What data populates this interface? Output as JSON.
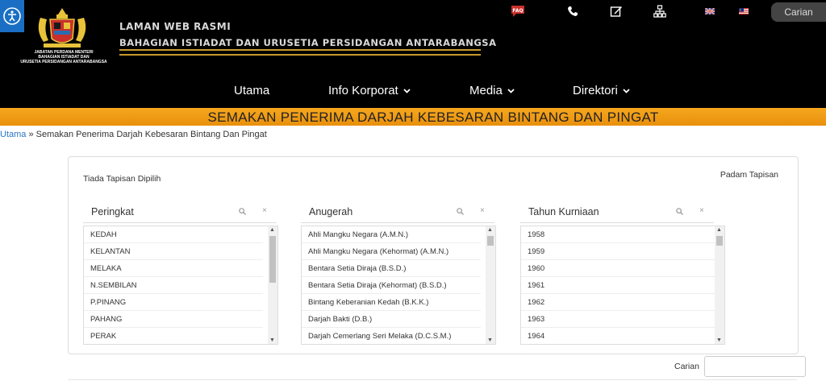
{
  "header": {
    "logo_caption": [
      "JABATAN PERDANA MENTERI",
      "BAHAGIAN ISTIADAT DAN",
      "URUSETIA PERSIDANGAN ANTARABANGSA"
    ],
    "title_line1": "LAMAN WEB RASMI",
    "title_line2": "BAHAGIAN ISTIADAT  DAN URUSETIA PERSIDANGAN ANTARABANGSA",
    "search_label": "Carian",
    "faq_label": "FAQ"
  },
  "nav": {
    "items": [
      {
        "label": "Utama"
      },
      {
        "label": "Info Korporat"
      },
      {
        "label": "Media"
      },
      {
        "label": "Direktori"
      }
    ]
  },
  "banner": {
    "title": "SEMAKAN PENERIMA DARJAH KEBESARAN BINTANG DAN PINGAT"
  },
  "breadcrumb": {
    "home": "Utama",
    "separator": "»",
    "current": "Semakan Penerima Darjah Kebesaran Bintang Dan Pingat"
  },
  "filters": {
    "no_filter": "Tiada Tapisan Dipilih",
    "clear": "Padam Tapisan",
    "columns": [
      {
        "title": "Peringkat",
        "items": [
          "KEDAH",
          "KELANTAN",
          "MELAKA",
          "N.SEMBILAN",
          "P.PINANG",
          "PAHANG",
          "PERAK"
        ]
      },
      {
        "title": "Anugerah",
        "items": [
          "Ahli Mangku Negara (A.M.N.)",
          "Ahli Mangku Negara (Kehormat) (A.M.N.)",
          "Bentara Setia Diraja (B.S.D.)",
          "Bentara Setia Diraja (Kehormat) (B.S.D.)",
          "Bintang Keberanian Kedah (B.K.K.)",
          "Darjah Bakti (D.B.)",
          "Darjah Cemerlang Seri Melaka (D.C.S.M.)"
        ]
      },
      {
        "title": "Tahun Kurniaan",
        "items": [
          "1958",
          "1959",
          "1960",
          "1961",
          "1962",
          "1963",
          "1964"
        ]
      }
    ]
  },
  "table_search": {
    "label": "Carian",
    "value": ""
  },
  "colors": {
    "accent": "#f6a81e",
    "header_bg": "#000000",
    "gold": "#c99a2a",
    "link": "#2a76c6"
  }
}
